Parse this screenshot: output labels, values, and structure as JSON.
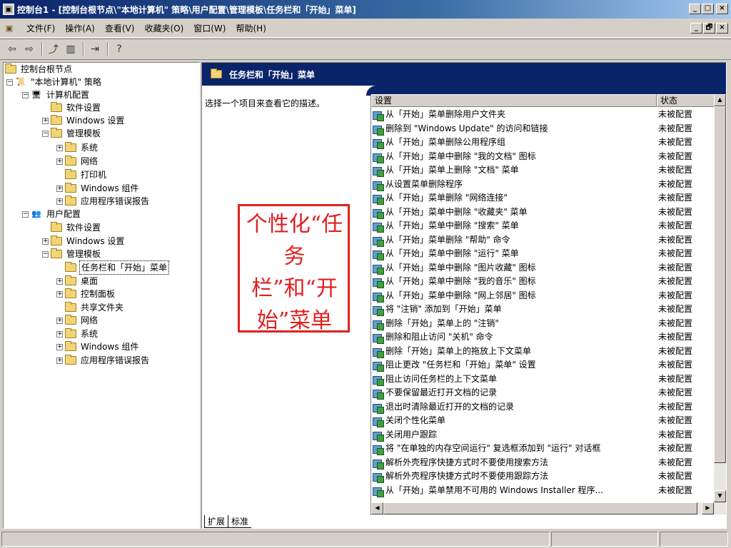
{
  "window": {
    "title": "控制台1 - [控制台根节点\\\"本地计算机\" 策略\\用户配置\\管理模板\\任务栏和「开始」菜单]",
    "minimize": "_",
    "maximize": "□",
    "close": "×",
    "restore": "🗗"
  },
  "menubar": {
    "items": [
      "文件(F)",
      "操作(A)",
      "查看(V)",
      "收藏夹(O)",
      "窗口(W)",
      "帮助(H)"
    ]
  },
  "toolbar": {
    "back_icon": "⇦",
    "forward_icon": "⇨",
    "up_icon": "⤴",
    "showtree_icon": "▥",
    "export_icon": "⇥",
    "help_icon": "?"
  },
  "tree": {
    "items": [
      {
        "label": "控制台根节点",
        "expander": ""
      },
      {
        "label": "\"本地计算机\" 策略",
        "expander": "−"
      },
      {
        "label": "计算机配置",
        "expander": "−"
      },
      {
        "label": "软件设置",
        "expander": ""
      },
      {
        "label": "Windows 设置",
        "expander": "+"
      },
      {
        "label": "管理模板",
        "expander": "−"
      },
      {
        "label": "系统",
        "expander": "+"
      },
      {
        "label": "网络",
        "expander": "+"
      },
      {
        "label": "打印机",
        "expander": ""
      },
      {
        "label": "Windows 组件",
        "expander": "+"
      },
      {
        "label": "应用程序错误报告",
        "expander": "+"
      },
      {
        "label": "用户配置",
        "expander": "−"
      },
      {
        "label": "软件设置",
        "expander": ""
      },
      {
        "label": "Windows 设置",
        "expander": "+"
      },
      {
        "label": "管理模板",
        "expander": "−"
      },
      {
        "label": "任务栏和「开始」菜单",
        "expander": ""
      },
      {
        "label": "桌面",
        "expander": "+"
      },
      {
        "label": "控制面板",
        "expander": "+"
      },
      {
        "label": "共享文件夹",
        "expander": ""
      },
      {
        "label": "网络",
        "expander": "+"
      },
      {
        "label": "系统",
        "expander": "+"
      },
      {
        "label": "Windows 组件",
        "expander": "+"
      },
      {
        "label": "应用程序错误报告",
        "expander": "+"
      }
    ]
  },
  "right": {
    "header_title": "任务栏和「开始」菜单",
    "description": "选择一个项目来查看它的描述。",
    "col_setting": "设置",
    "col_state": "状态",
    "rows": [
      {
        "name": "从「开始」菜单删除用户文件夹",
        "state": "未被配置"
      },
      {
        "name": "删除到 \"Windows Update\" 的访问和链接",
        "state": "未被配置"
      },
      {
        "name": "从「开始」菜单删除公用程序组",
        "state": "未被配置"
      },
      {
        "name": "从「开始」菜单中删除 \"我的文档\" 图标",
        "state": "未被配置"
      },
      {
        "name": "从「开始」菜单上删除 \"文档\" 菜单",
        "state": "未被配置"
      },
      {
        "name": "从设置菜单删除程序",
        "state": "未被配置"
      },
      {
        "name": "从「开始」菜单删除 \"网络连接\"",
        "state": "未被配置"
      },
      {
        "name": "从「开始」菜单中删除 \"收藏夹\" 菜单",
        "state": "未被配置"
      },
      {
        "name": "从「开始」菜单中删除 \"搜索\" 菜单",
        "state": "未被配置"
      },
      {
        "name": "从「开始」菜单删除 \"帮助\" 命令",
        "state": "未被配置"
      },
      {
        "name": "从「开始」菜单中删除 \"运行\" 菜单",
        "state": "未被配置"
      },
      {
        "name": "从「开始」菜单中删除 \"图片收藏\" 图标",
        "state": "未被配置"
      },
      {
        "name": "从「开始」菜单中删除 \"我的音乐\" 图标",
        "state": "未被配置"
      },
      {
        "name": "从「开始」菜单中删除 \"网上邻居\" 图标",
        "state": "未被配置"
      },
      {
        "name": "将 \"注销\" 添加到「开始」菜单",
        "state": "未被配置"
      },
      {
        "name": "删除「开始」菜单上的 \"注销\"",
        "state": "未被配置"
      },
      {
        "name": "删除和阻止访问 \"关机\" 命令",
        "state": "未被配置"
      },
      {
        "name": "删除「开始」菜单上的拖放上下文菜单",
        "state": "未被配置"
      },
      {
        "name": "阻止更改 \"任务栏和「开始」菜单\" 设置",
        "state": "未被配置"
      },
      {
        "name": "阻止访问任务栏的上下文菜单",
        "state": "未被配置"
      },
      {
        "name": "不要保留最近打开文档的记录",
        "state": "未被配置"
      },
      {
        "name": "退出时清除最近打开的文档的记录",
        "state": "未被配置"
      },
      {
        "name": "关闭个性化菜单",
        "state": "未被配置"
      },
      {
        "name": "关闭用户跟踪",
        "state": "未被配置"
      },
      {
        "name": "将 \"在单独的内存空间运行\" 复选框添加到 \"运行\" 对话框",
        "state": "未被配置"
      },
      {
        "name": "解析外壳程序快捷方式时不要使用搜索方法",
        "state": "未被配置"
      },
      {
        "name": "解析外壳程序快捷方式时不要使用跟踪方法",
        "state": "未被配置"
      },
      {
        "name": "从「开始」菜单禁用不可用的 Windows Installer 程序...",
        "state": "未被配置"
      }
    ]
  },
  "tabs": {
    "extended": "扩展",
    "standard": "标准"
  },
  "overlay": {
    "text": "个性化“任务栏”和“开始”菜单"
  },
  "colors": {
    "accent": "#0a246a",
    "overlay": "#e02020"
  }
}
